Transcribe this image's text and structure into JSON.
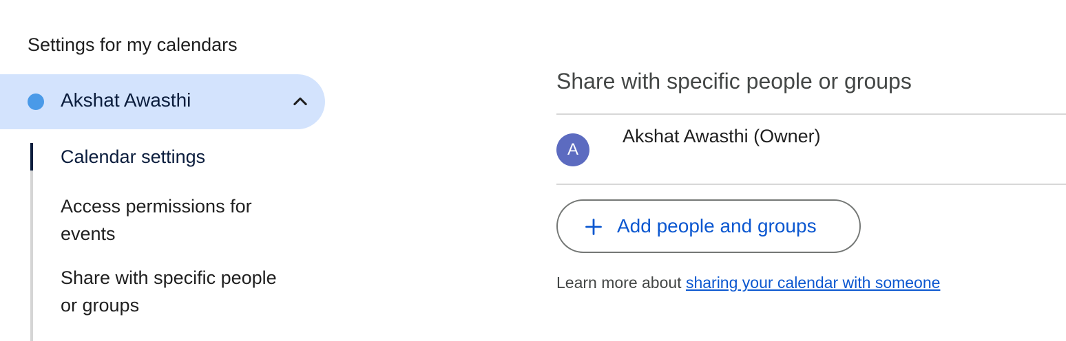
{
  "sidebar": {
    "heading": "Settings for my calendars",
    "calendar": {
      "name": "Akshat Awasthi",
      "dot_color": "#4a9ae8",
      "expand_icon": "chevron-up-icon"
    },
    "items": [
      {
        "label": "Calendar settings",
        "active": true
      },
      {
        "label_line1": "Access permissions for",
        "label_line2": "events"
      },
      {
        "label_line1": "Share with specific people",
        "label_line2": "or groups"
      }
    ]
  },
  "main": {
    "section_title": "Share with specific people or groups",
    "owner": {
      "avatar_letter": "A",
      "name": "Akshat Awasthi (Owner)",
      "avatar_color": "#5c6bc0"
    },
    "add_button": {
      "icon": "plus-icon",
      "label": "Add people and groups"
    },
    "learn_more": {
      "prefix": "Learn more about ",
      "link_text": "sharing your calendar with someone"
    }
  },
  "colors": {
    "accent": "#0b57d0",
    "selected_bg": "#d3e3fd",
    "text_dark": "#0b1d3d"
  }
}
